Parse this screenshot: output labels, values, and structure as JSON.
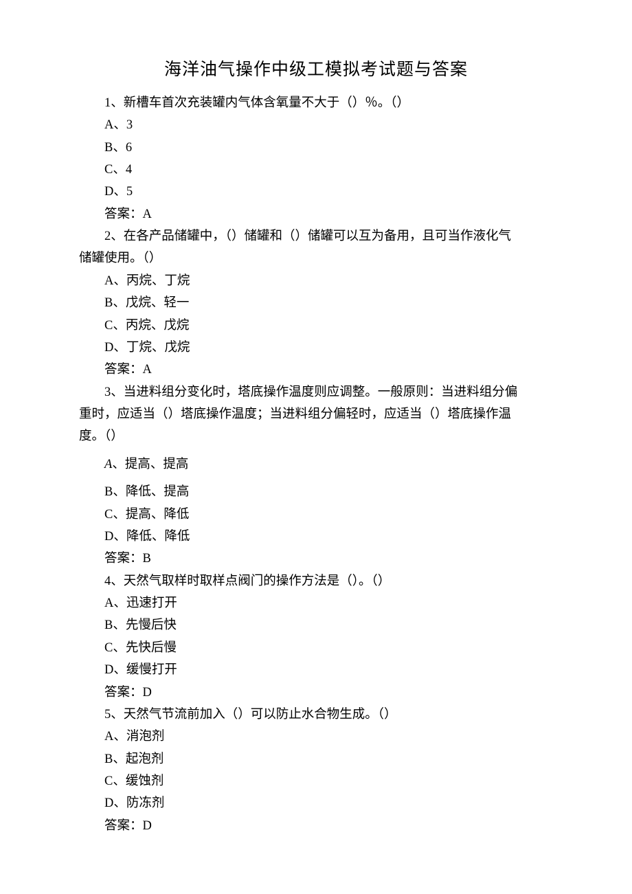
{
  "title": "海洋油气操作中级工模拟考试题与答案",
  "q1": {
    "stem": "1、新槽车首次充装罐内气体含氧量不大于（）％。（）",
    "a": "A、3",
    "b": "B、6",
    "c": "C、4",
    "d": "D、5",
    "ans": "答案：A"
  },
  "q2": {
    "stem1": "2、在各产品储罐中，（）储罐和（）储罐可以互为备用，且可当作液化气",
    "stem2": "储罐使用。（）",
    "a": "A、丙烷、丁烷",
    "b": "B、戊烷、轻一",
    "c": "C、丙烷、戊烷",
    "d": "D、丁烷、戊烷",
    "ans": "答案：A"
  },
  "q3": {
    "stem1": "3、当进料组分变化时，塔底操作温度则应调整。一般原则：当进料组分偏",
    "stem2": "重时，应适当（）塔底操作温度；当进料组分偏轻时，应适当（）塔底操作温",
    "stem3": "度。（）",
    "a_prefix": "A",
    "a_rest": "、提高、提高",
    "b": "B、降低、提高",
    "c": "C、提高、降低",
    "d": "D、降低、降低",
    "ans": "答案：B"
  },
  "q4": {
    "stem": "4、天然气取样时取样点阀门的操作方法是（）。（）",
    "a": "A、迅速打开",
    "b": "B、先慢后快",
    "c": "C、先快后慢",
    "d": "D、缓慢打开",
    "ans": "答案：D"
  },
  "q5": {
    "stem": "5、天然气节流前加入（）可以防止水合物生成。（）",
    "a": "A、消泡剂",
    "b": "B、起泡剂",
    "c": "C、缓蚀剂",
    "d": "D、防冻剂",
    "ans": "答案：D"
  }
}
